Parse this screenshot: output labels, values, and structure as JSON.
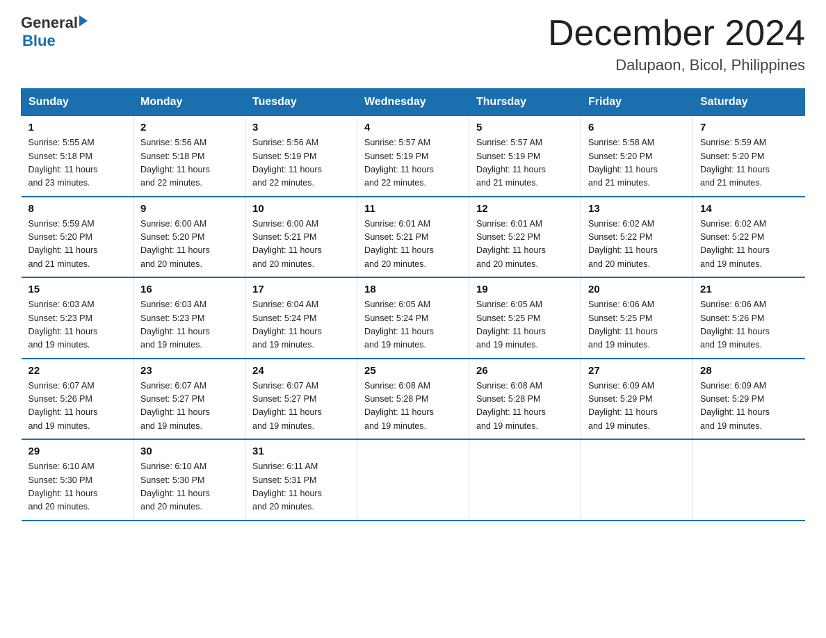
{
  "header": {
    "logo_general": "General",
    "logo_blue": "Blue",
    "month_title": "December 2024",
    "location": "Dalupaon, Bicol, Philippines"
  },
  "days_of_week": [
    "Sunday",
    "Monday",
    "Tuesday",
    "Wednesday",
    "Thursday",
    "Friday",
    "Saturday"
  ],
  "weeks": [
    [
      {
        "day": "1",
        "sunrise": "5:55 AM",
        "sunset": "5:18 PM",
        "daylight": "11 hours and 23 minutes."
      },
      {
        "day": "2",
        "sunrise": "5:56 AM",
        "sunset": "5:18 PM",
        "daylight": "11 hours and 22 minutes."
      },
      {
        "day": "3",
        "sunrise": "5:56 AM",
        "sunset": "5:19 PM",
        "daylight": "11 hours and 22 minutes."
      },
      {
        "day": "4",
        "sunrise": "5:57 AM",
        "sunset": "5:19 PM",
        "daylight": "11 hours and 22 minutes."
      },
      {
        "day": "5",
        "sunrise": "5:57 AM",
        "sunset": "5:19 PM",
        "daylight": "11 hours and 21 minutes."
      },
      {
        "day": "6",
        "sunrise": "5:58 AM",
        "sunset": "5:20 PM",
        "daylight": "11 hours and 21 minutes."
      },
      {
        "day": "7",
        "sunrise": "5:59 AM",
        "sunset": "5:20 PM",
        "daylight": "11 hours and 21 minutes."
      }
    ],
    [
      {
        "day": "8",
        "sunrise": "5:59 AM",
        "sunset": "5:20 PM",
        "daylight": "11 hours and 21 minutes."
      },
      {
        "day": "9",
        "sunrise": "6:00 AM",
        "sunset": "5:20 PM",
        "daylight": "11 hours and 20 minutes."
      },
      {
        "day": "10",
        "sunrise": "6:00 AM",
        "sunset": "5:21 PM",
        "daylight": "11 hours and 20 minutes."
      },
      {
        "day": "11",
        "sunrise": "6:01 AM",
        "sunset": "5:21 PM",
        "daylight": "11 hours and 20 minutes."
      },
      {
        "day": "12",
        "sunrise": "6:01 AM",
        "sunset": "5:22 PM",
        "daylight": "11 hours and 20 minutes."
      },
      {
        "day": "13",
        "sunrise": "6:02 AM",
        "sunset": "5:22 PM",
        "daylight": "11 hours and 20 minutes."
      },
      {
        "day": "14",
        "sunrise": "6:02 AM",
        "sunset": "5:22 PM",
        "daylight": "11 hours and 19 minutes."
      }
    ],
    [
      {
        "day": "15",
        "sunrise": "6:03 AM",
        "sunset": "5:23 PM",
        "daylight": "11 hours and 19 minutes."
      },
      {
        "day": "16",
        "sunrise": "6:03 AM",
        "sunset": "5:23 PM",
        "daylight": "11 hours and 19 minutes."
      },
      {
        "day": "17",
        "sunrise": "6:04 AM",
        "sunset": "5:24 PM",
        "daylight": "11 hours and 19 minutes."
      },
      {
        "day": "18",
        "sunrise": "6:05 AM",
        "sunset": "5:24 PM",
        "daylight": "11 hours and 19 minutes."
      },
      {
        "day": "19",
        "sunrise": "6:05 AM",
        "sunset": "5:25 PM",
        "daylight": "11 hours and 19 minutes."
      },
      {
        "day": "20",
        "sunrise": "6:06 AM",
        "sunset": "5:25 PM",
        "daylight": "11 hours and 19 minutes."
      },
      {
        "day": "21",
        "sunrise": "6:06 AM",
        "sunset": "5:26 PM",
        "daylight": "11 hours and 19 minutes."
      }
    ],
    [
      {
        "day": "22",
        "sunrise": "6:07 AM",
        "sunset": "5:26 PM",
        "daylight": "11 hours and 19 minutes."
      },
      {
        "day": "23",
        "sunrise": "6:07 AM",
        "sunset": "5:27 PM",
        "daylight": "11 hours and 19 minutes."
      },
      {
        "day": "24",
        "sunrise": "6:07 AM",
        "sunset": "5:27 PM",
        "daylight": "11 hours and 19 minutes."
      },
      {
        "day": "25",
        "sunrise": "6:08 AM",
        "sunset": "5:28 PM",
        "daylight": "11 hours and 19 minutes."
      },
      {
        "day": "26",
        "sunrise": "6:08 AM",
        "sunset": "5:28 PM",
        "daylight": "11 hours and 19 minutes."
      },
      {
        "day": "27",
        "sunrise": "6:09 AM",
        "sunset": "5:29 PM",
        "daylight": "11 hours and 19 minutes."
      },
      {
        "day": "28",
        "sunrise": "6:09 AM",
        "sunset": "5:29 PM",
        "daylight": "11 hours and 19 minutes."
      }
    ],
    [
      {
        "day": "29",
        "sunrise": "6:10 AM",
        "sunset": "5:30 PM",
        "daylight": "11 hours and 20 minutes."
      },
      {
        "day": "30",
        "sunrise": "6:10 AM",
        "sunset": "5:30 PM",
        "daylight": "11 hours and 20 minutes."
      },
      {
        "day": "31",
        "sunrise": "6:11 AM",
        "sunset": "5:31 PM",
        "daylight": "11 hours and 20 minutes."
      },
      null,
      null,
      null,
      null
    ]
  ],
  "labels": {
    "sunrise": "Sunrise:",
    "sunset": "Sunset:",
    "daylight": "Daylight:"
  }
}
